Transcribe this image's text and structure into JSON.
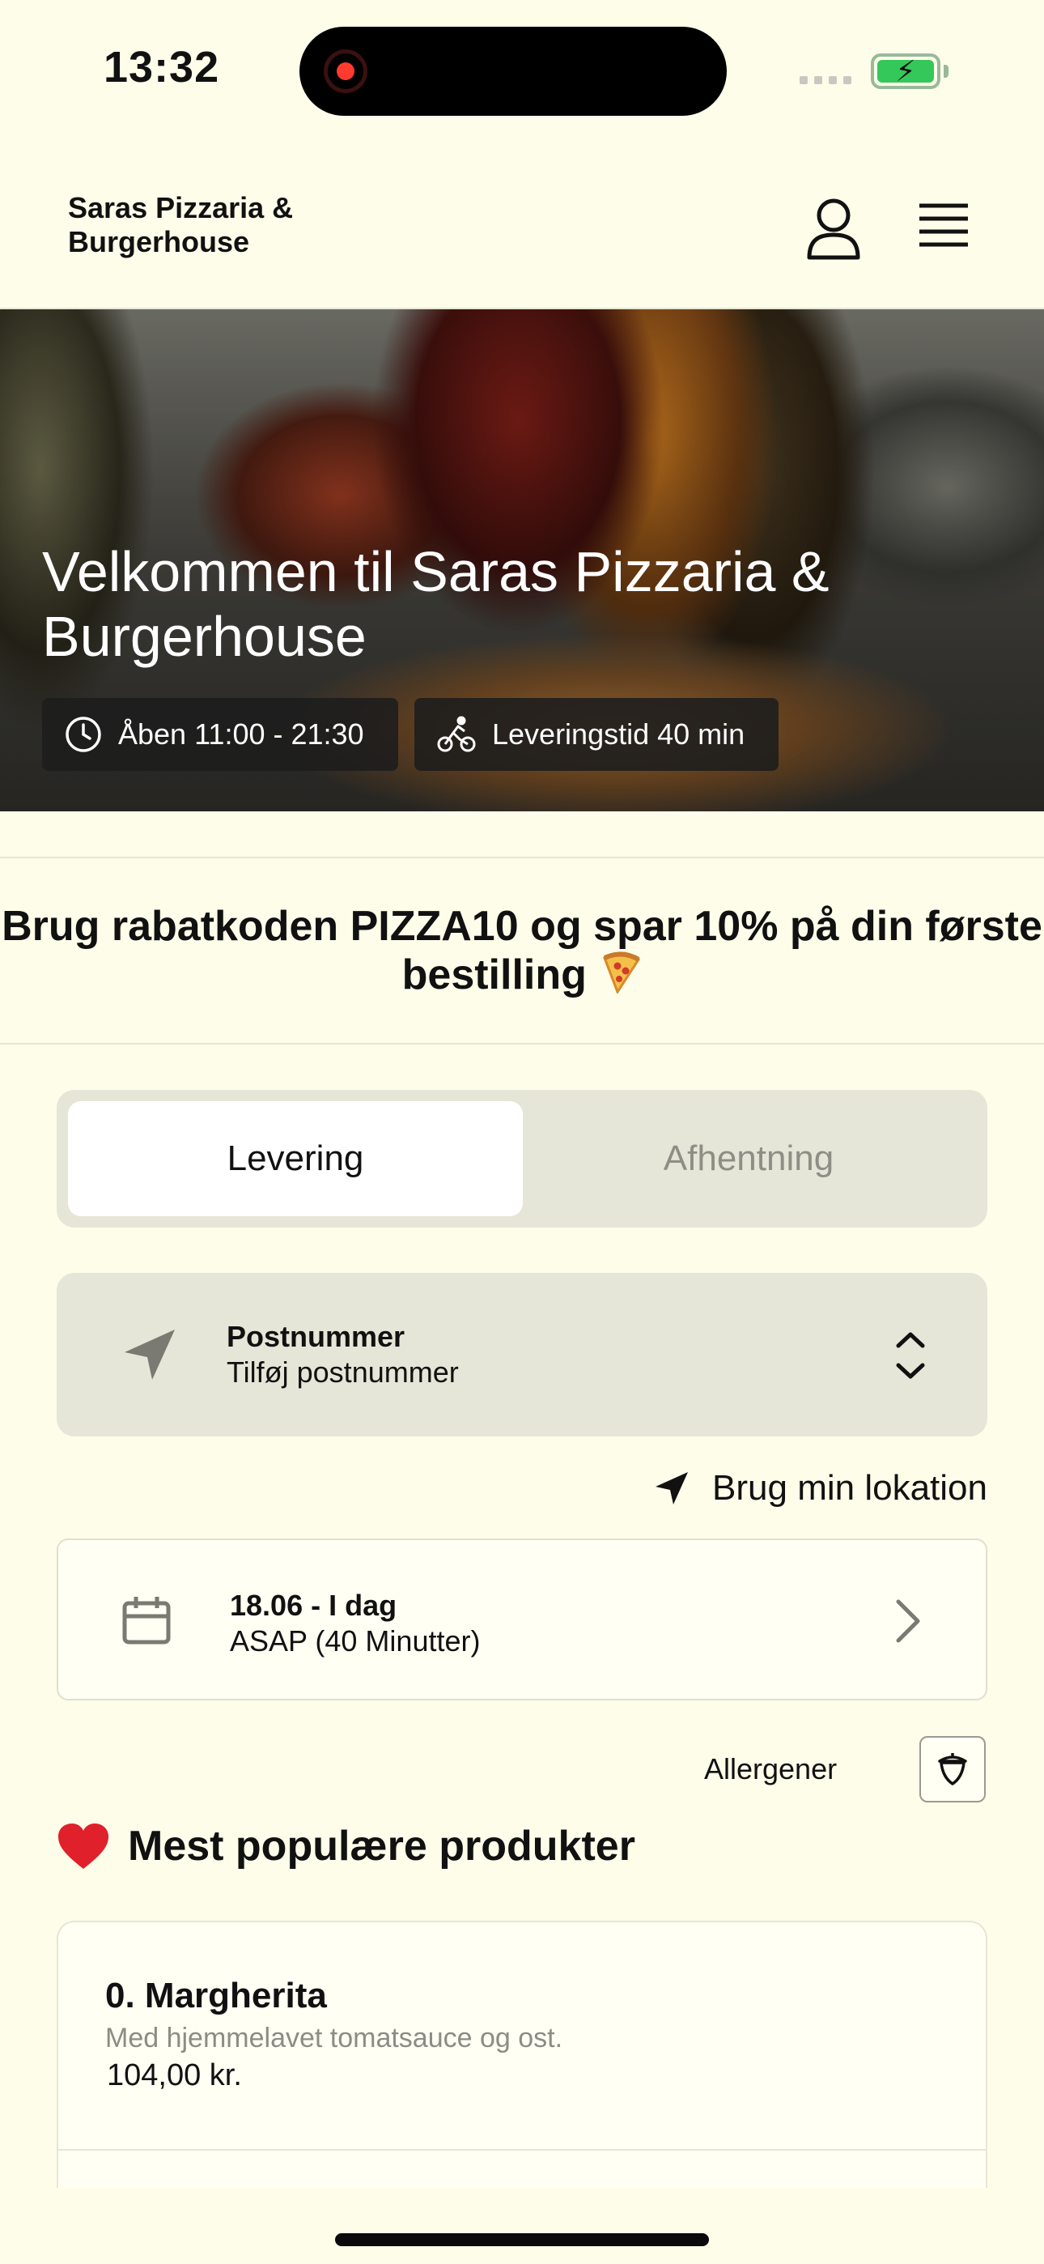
{
  "status_bar": {
    "time": "13:32",
    "battery_color": "#34c759",
    "recording_color": "#ff3b30"
  },
  "header": {
    "brand": "Saras Pizzaria & Burgerhouse",
    "icons": [
      "user-icon",
      "hamburger-menu-icon"
    ]
  },
  "hero": {
    "title": "Velkommen til Saras Pizzaria & Burgerhouse",
    "opening_hours": "Åben 11:00 - 21:30",
    "delivery_time": "Leveringstid 40 min",
    "icons": [
      "clock-icon",
      "cyclist-icon"
    ]
  },
  "promo": {
    "text": "Brug rabatkoden PIZZA10 og spar 10% på din første bestilling",
    "emoji": "pizza-emoji"
  },
  "order_type": {
    "options": [
      "Levering",
      "Afhentning"
    ],
    "selected": "Levering"
  },
  "postcode": {
    "label": "Postnummer",
    "value": "Tilføj postnummer"
  },
  "location": {
    "label": "Brug min lokation"
  },
  "schedule": {
    "date": "18.06 - I dag",
    "time": "ASAP (40 Minutter)"
  },
  "allergens": {
    "label": "Allergener"
  },
  "popular": {
    "title": "Mest populære produkter",
    "products": [
      {
        "name": "0. Margherita",
        "description": "Med hjemmelavet tomatsauce og ost.",
        "price": "104,00 kr."
      }
    ]
  },
  "colors": {
    "background": "#fdfdea",
    "segment_bg": "#e6e6d8",
    "accent_heart": "#e0202a"
  }
}
